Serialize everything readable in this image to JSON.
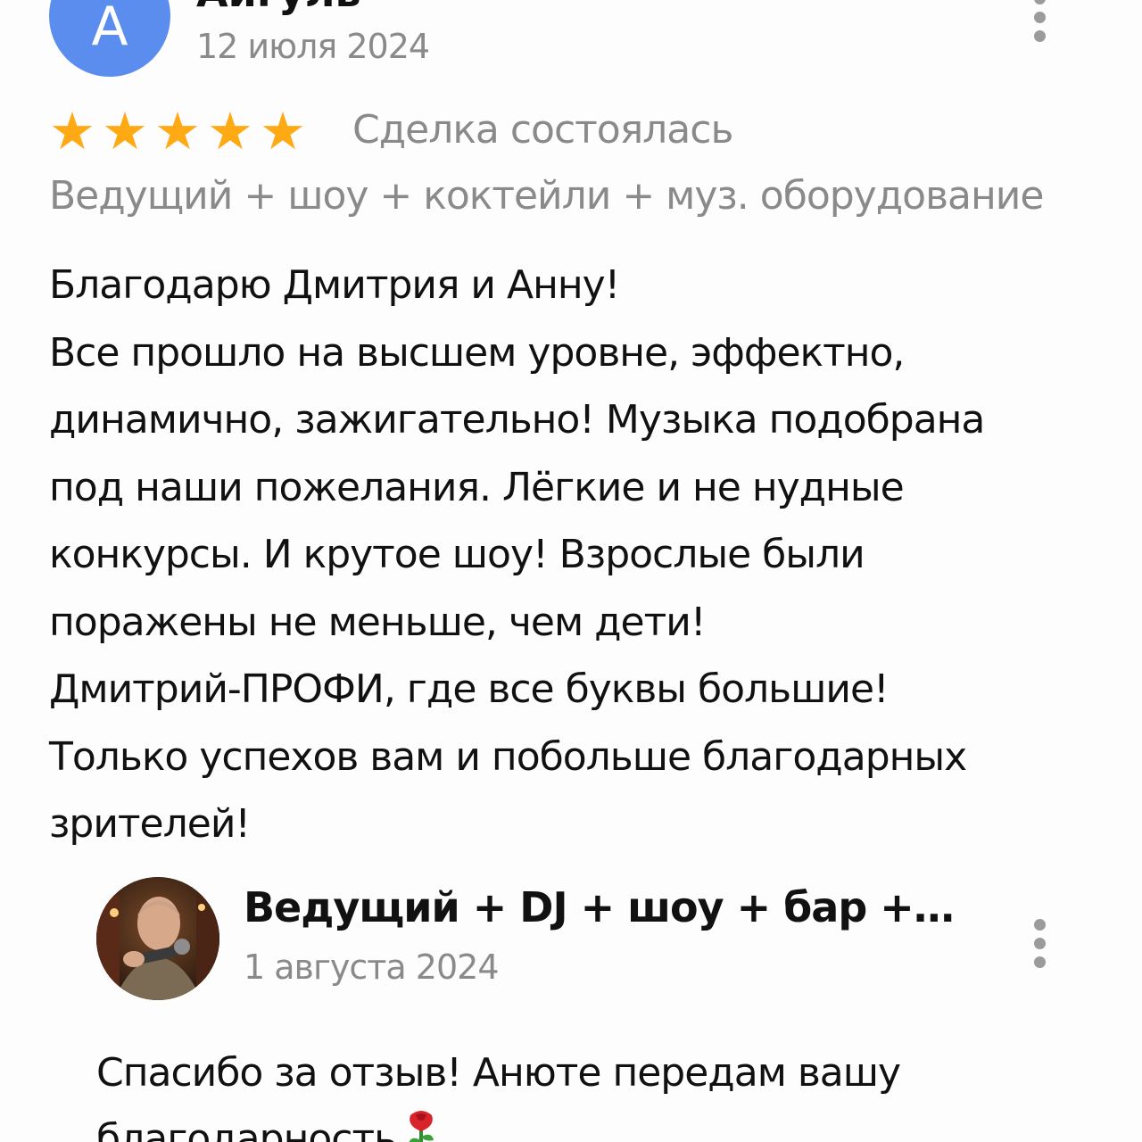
{
  "review": {
    "author": "Айгуль",
    "avatar_letter": "А",
    "date": "12 июля 2024",
    "rating": 5,
    "status": "Сделка состоялась",
    "service": "Ведущий + шоу + коктейли + муз. оборудование",
    "text_lines": [
      "Благодарю Дмитрия и Анну!",
      "Все прошло на высшем уровне, эффектно,",
      "динамично, зажигательно! Музыка подобрана",
      "под наши пожелания. Лёгкие и не нудные",
      "конкурсы. И крутое шоу! Взрослые были",
      "поражены не меньше, чем дети!",
      "Дмитрий-ПРОФИ, где все буквы большие!",
      "Только успехов вам и побольше благодарных",
      "зрителей!"
    ],
    "menu_icon": "more-vertical-icon"
  },
  "reply": {
    "author": "Ведущий + DJ + шоу + бар + к...",
    "date": "1 августа 2024",
    "text_lines": [
      "Спасибо за отзыв! Анюте передам вашу",
      "благодарность"
    ],
    "emoji": "rose-icon",
    "menu_icon": "more-vertical-icon"
  },
  "colors": {
    "star": "#ffaa14",
    "avatar_bg": "#5b8def",
    "muted_text": "#8a8a8a"
  }
}
